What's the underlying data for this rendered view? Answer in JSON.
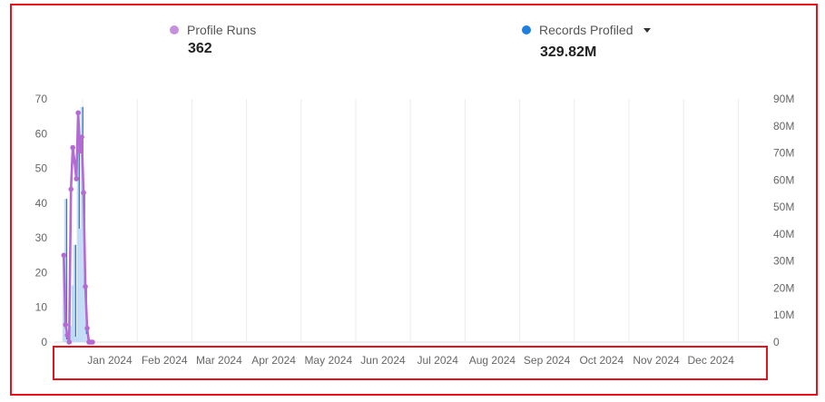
{
  "colors": {
    "profile_runs": "#b36ad1",
    "records_profiled": "#1e7fe0",
    "records_fill": "#c9dff5",
    "grid": "#ececec",
    "highlight": "#e8101a"
  },
  "legend": {
    "profile_runs": {
      "label": "Profile Runs",
      "value": "362"
    },
    "records_profiled": {
      "label": "Records Profiled",
      "value": "329.82M",
      "icon": "caret-down-icon"
    }
  },
  "chart_data": {
    "type": "line",
    "x_axis": {
      "categories": [
        "Jan 2024",
        "Feb 2024",
        "Mar 2024",
        "Apr 2024",
        "May 2024",
        "Jun 2024",
        "Jul 2024",
        "Aug 2024",
        "Sep 2024",
        "Oct 2024",
        "Nov 2024",
        "Dec 2024"
      ]
    },
    "y_left": {
      "ticks": [
        "0",
        "10",
        "20",
        "30",
        "40",
        "50",
        "60",
        "70"
      ],
      "ylim": [
        0,
        70
      ]
    },
    "y_right": {
      "ticks": [
        "0",
        "10M",
        "20M",
        "30M",
        "40M",
        "50M",
        "60M",
        "70M",
        "80M",
        "90M"
      ],
      "ylim": [
        0,
        90000000
      ]
    },
    "legend_position": "top",
    "grid": "vertical",
    "series": [
      {
        "name": "Profile Runs",
        "axis": "left",
        "style": "line",
        "x": [
          "2023-12-18",
          "2023-12-19",
          "2023-12-20",
          "2023-12-21",
          "2023-12-22",
          "2023-12-23",
          "2023-12-24",
          "2023-12-25",
          "2023-12-26",
          "2023-12-27",
          "2023-12-28",
          "2023-12-29",
          "2023-12-30",
          "2023-12-31",
          "2024-01-01",
          "2024-01-02",
          "2024-01-03"
        ],
        "values": [
          25,
          5,
          2,
          0,
          44,
          56,
          52,
          47,
          66,
          55,
          59,
          43,
          16,
          4,
          0,
          0,
          0
        ]
      },
      {
        "name": "Records Profiled",
        "axis": "right",
        "style": "bar",
        "x": [
          "2023-12-18",
          "2023-12-19",
          "2023-12-20",
          "2023-12-21",
          "2023-12-22",
          "2023-12-23",
          "2023-12-24",
          "2023-12-25",
          "2023-12-26",
          "2023-12-27",
          "2023-12-28",
          "2023-12-29",
          "2023-12-30",
          "2023-12-31"
        ],
        "values": [
          33000000,
          53000000,
          1000000,
          0,
          6000000,
          21000000,
          36000000,
          2000000,
          75000000,
          42000000,
          87000000,
          56000000,
          20000000,
          3000000
        ]
      }
    ]
  }
}
